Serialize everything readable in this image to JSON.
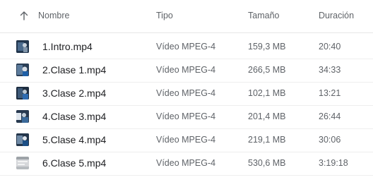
{
  "columns": {
    "name": "Nombre",
    "type": "Tipo",
    "size": "Tamaño",
    "duration": "Duración",
    "sort_icon": "arrow-up-icon"
  },
  "files": [
    {
      "name": "1.Intro.mp4",
      "type": "Vídeo MPEG-4",
      "size": "159,3 MB",
      "duration": "20:40",
      "thumb": "video-thumbnail"
    },
    {
      "name": "2.Clase 1.mp4",
      "type": "Vídeo MPEG-4",
      "size": "266,5 MB",
      "duration": "34:33",
      "thumb": "video-thumbnail"
    },
    {
      "name": "3.Clase 2.mp4",
      "type": "Vídeo MPEG-4",
      "size": "102,1 MB",
      "duration": "13:21",
      "thumb": "video-thumbnail"
    },
    {
      "name": "4.Clase 3.mp4",
      "type": "Vídeo MPEG-4",
      "size": "201,4 MB",
      "duration": "26:44",
      "thumb": "video-thumbnail"
    },
    {
      "name": "5.Clase 4.mp4",
      "type": "Vídeo MPEG-4",
      "size": "219,1 MB",
      "duration": "30:06",
      "thumb": "video-thumbnail"
    },
    {
      "name": "6.Clase 5.mp4",
      "type": "Vídeo MPEG-4",
      "size": "530,6 MB",
      "duration": "3:19:18",
      "thumb": "video-thumbnail"
    }
  ]
}
